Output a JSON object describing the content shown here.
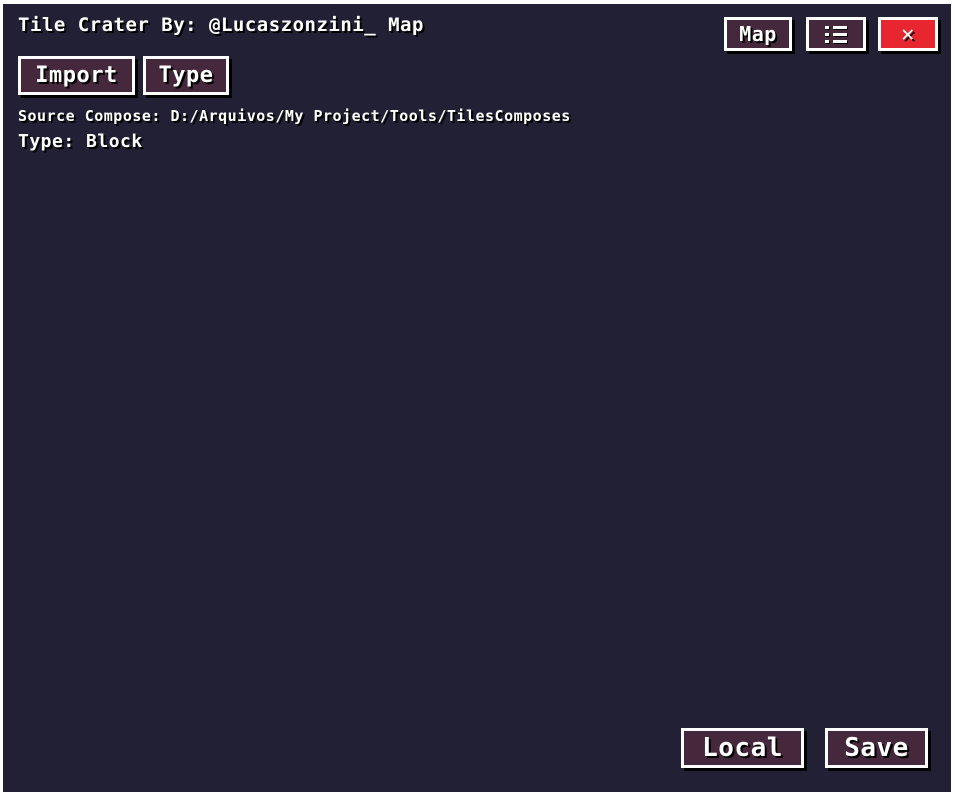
{
  "window": {
    "title": "Tile Crater By: @Lucaszonzini_ Map"
  },
  "toolbar": {
    "map_label": "Map",
    "menu_icon": "menu-icon",
    "close_icon": "close-icon",
    "close_glyph": "✕",
    "import_label": "Import",
    "type_label": "Type"
  },
  "info": {
    "source_compose": "Source Compose: D:/Arquivos/My Project/Tools/TilesComposes",
    "type": "Type: Block"
  },
  "footer": {
    "local_label": "Local",
    "save_label": "Save"
  },
  "colors": {
    "background": "#222034",
    "button": "#45283c",
    "close_button": "#e8262f",
    "text": "#ffffff"
  }
}
